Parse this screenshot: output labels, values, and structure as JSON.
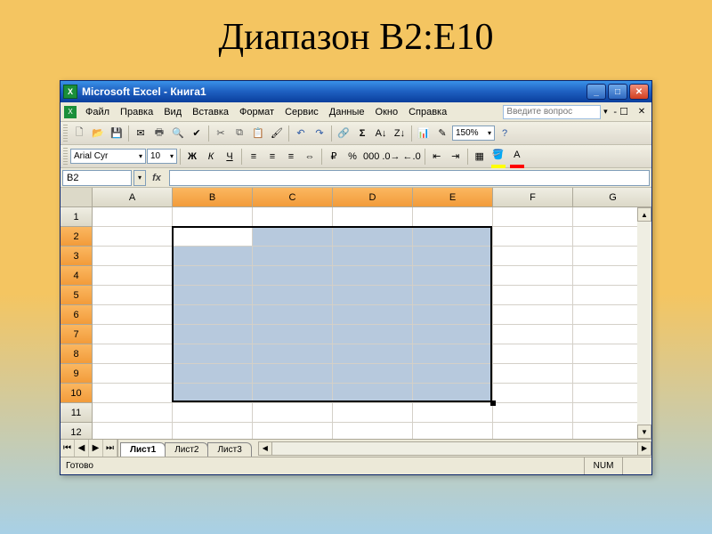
{
  "slide": {
    "title": "Диапазон B2:E10"
  },
  "window": {
    "title": "Microsoft Excel - Книга1"
  },
  "menu": {
    "file": "Файл",
    "edit": "Правка",
    "view": "Вид",
    "insert": "Вставка",
    "format": "Формат",
    "tools": "Сервис",
    "data": "Данные",
    "window_m": "Окно",
    "help": "Справка",
    "help_placeholder": "Введите вопрос"
  },
  "toolbar": {
    "zoom": "150%"
  },
  "format_toolbar": {
    "font_name": "Arial Cyr",
    "font_size": "10"
  },
  "namebox": {
    "value": "B2"
  },
  "columns": [
    "A",
    "B",
    "C",
    "D",
    "E",
    "F",
    "G"
  ],
  "rows": [
    "1",
    "2",
    "3",
    "4",
    "5",
    "6",
    "7",
    "8",
    "9",
    "10",
    "11",
    "12"
  ],
  "selection": {
    "active_cell": "B2",
    "range": "B2:E10",
    "col_indices_selected": [
      1,
      2,
      3,
      4
    ],
    "row_indices_selected": [
      1,
      2,
      3,
      4,
      5,
      6,
      7,
      8,
      9
    ]
  },
  "sheets": {
    "active": "Лист1",
    "tabs": [
      "Лист1",
      "Лист2",
      "Лист3"
    ]
  },
  "status": {
    "ready": "Готово",
    "num": "NUM"
  }
}
